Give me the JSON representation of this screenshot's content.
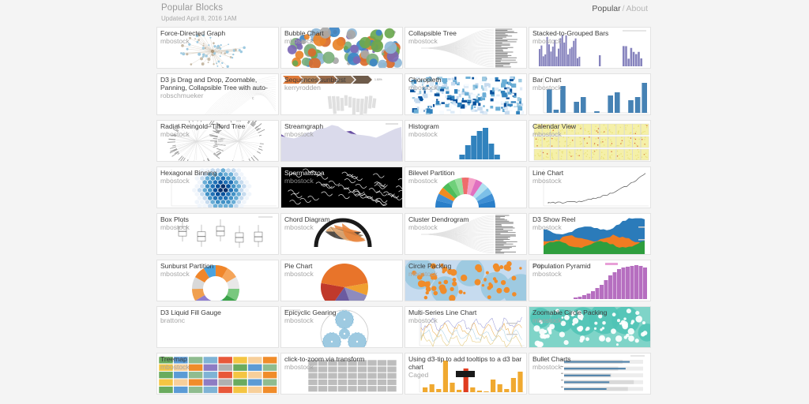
{
  "header": {
    "title": "Popular Blocks",
    "subtitle": "Updated April 8, 2016 1AM",
    "nav": {
      "current": "Popular",
      "separator": "/",
      "other": "About"
    }
  },
  "blocks": [
    {
      "title": "Force-Directed Graph",
      "author": "mbostock",
      "thumb": "force-directed-graph"
    },
    {
      "title": "Bubble Chart",
      "author": "mbostock",
      "thumb": "bubble-chart"
    },
    {
      "title": "Collapsible Tree",
      "author": "mbostock",
      "thumb": "collapsible-tree"
    },
    {
      "title": "Stacked-to-Grouped Bars",
      "author": "mbostock",
      "thumb": "stacked-to-grouped-bars"
    },
    {
      "title": "D3 js Drag and Drop, Zoomable, Panning, Collapsible Tree with auto-",
      "author": "robschmueker",
      "thumb": "collapsible-tree-pan"
    },
    {
      "title": "Sequences sunburst",
      "author": "kerryrodden",
      "thumb": "sequences-sunburst"
    },
    {
      "title": "Choropleth",
      "author": "mbostock",
      "thumb": "choropleth"
    },
    {
      "title": "Bar Chart",
      "author": "mbostock",
      "thumb": "bar-chart"
    },
    {
      "title": "Radial Reingold–Tilford Tree",
      "author": "mbostock",
      "thumb": "radial-tree"
    },
    {
      "title": "Streamgraph",
      "author": "mbostock",
      "thumb": "streamgraph"
    },
    {
      "title": "Histogram",
      "author": "mbostock",
      "thumb": "histogram"
    },
    {
      "title": "Calendar View",
      "author": "mbostock",
      "thumb": "calendar-view"
    },
    {
      "title": "Hexagonal Binning",
      "author": "mbostock",
      "thumb": "hexagonal-binning"
    },
    {
      "title": "Spermatozoa",
      "author": "mbostock",
      "thumb": "spermatozoa",
      "dark": true
    },
    {
      "title": "Bilevel Partition",
      "author": "mbostock",
      "thumb": "bilevel-partition"
    },
    {
      "title": "Line Chart",
      "author": "mbostock",
      "thumb": "line-chart"
    },
    {
      "title": "Box Plots",
      "author": "mbostock",
      "thumb": "box-plots"
    },
    {
      "title": "Chord Diagram",
      "author": "mbostock",
      "thumb": "chord-diagram"
    },
    {
      "title": "Cluster Dendrogram",
      "author": "mbostock",
      "thumb": "cluster-dendrogram"
    },
    {
      "title": "D3 Show Reel",
      "author": "mbostock",
      "thumb": "show-reel"
    },
    {
      "title": "Sunburst Partition",
      "author": "mbostock",
      "thumb": "sunburst-partition"
    },
    {
      "title": "Pie Chart",
      "author": "mbostock",
      "thumb": "pie-chart"
    },
    {
      "title": "Circle Packing",
      "author": "mbostock",
      "thumb": "circle-packing"
    },
    {
      "title": "Population Pyramid",
      "author": "mbostock",
      "thumb": "population-pyramid"
    },
    {
      "title": "D3 Liquid Fill Gauge",
      "author": "brattonc",
      "thumb": "blank"
    },
    {
      "title": "Epicyclic Gearing",
      "author": "mbostock",
      "thumb": "epicyclic-gearing"
    },
    {
      "title": "Multi-Series Line Chart",
      "author": "mbostock",
      "thumb": "multi-series-line-chart"
    },
    {
      "title": "Zoomable Circle Packing",
      "author": "mbostock",
      "thumb": "zoomable-circle-packing"
    },
    {
      "title": "Treemap",
      "author": "mbostock",
      "thumb": "treemap"
    },
    {
      "title": "click-to-zoom via transform",
      "author": "mbostock",
      "thumb": "click-to-zoom"
    },
    {
      "title": "Using d3-tip to add tooltips to a d3 bar chart",
      "author": "Caged",
      "thumb": "d3-tip-bar-chart"
    },
    {
      "title": "Bullet Charts",
      "author": "mbostock",
      "thumb": "bullet-charts"
    }
  ],
  "colors": {
    "page_background": "#f4f4f4",
    "card_background": "#ffffff",
    "title_text": "#3b3b3b",
    "author_text": "#a6a6a6",
    "header_text": "#9a9a9a"
  }
}
